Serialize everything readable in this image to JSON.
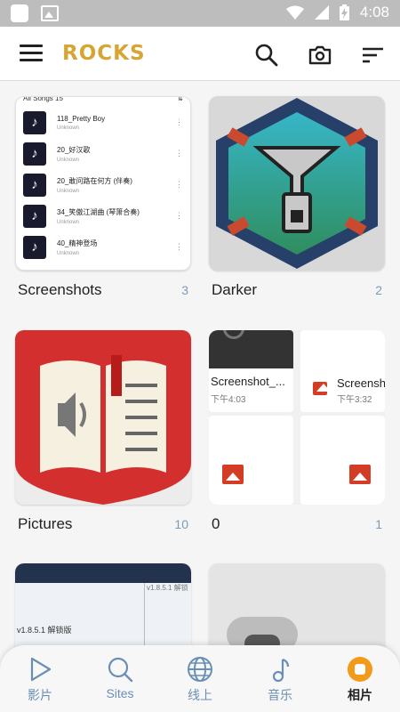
{
  "status_bar": {
    "time": "4:08"
  },
  "header": {
    "logo_text": "ROCKS"
  },
  "albums": [
    {
      "name": "Screenshots",
      "count": "3",
      "preview": {
        "title": "All Songs 15",
        "songs": [
          {
            "title": "118_Pretty Boy",
            "artist": "Unknown"
          },
          {
            "title": "20_好汉歌",
            "artist": "Unknown"
          },
          {
            "title": "20_敢问路在何方 (伴奏)",
            "artist": "Unknown"
          },
          {
            "title": "34_笑傲江湖曲 (琴箫合奏)",
            "artist": "Unknown"
          },
          {
            "title": "40_精神登场",
            "artist": "Unknown"
          }
        ]
      }
    },
    {
      "name": "Darker",
      "count": "2"
    },
    {
      "name": "Pictures",
      "count": "10"
    },
    {
      "name": "0",
      "count": "1",
      "items": [
        {
          "name": "Screenshot_...",
          "time": "下午4:03"
        },
        {
          "name": "Screensh",
          "time": "下午3:32"
        }
      ]
    },
    {
      "preview": {
        "heading": "v1.8.5.1 解锁版",
        "corner_text": "v1.8.5.1 解锁"
      }
    },
    {}
  ],
  "bottom_nav": [
    {
      "label": "影片",
      "icon": "play-icon"
    },
    {
      "label": "Sites",
      "icon": "search-icon"
    },
    {
      "label": "线上",
      "icon": "globe-icon"
    },
    {
      "label": "音乐",
      "icon": "music-note-icon"
    },
    {
      "label": "相片",
      "icon": "photo-icon",
      "active": true
    }
  ],
  "colors": {
    "accent": "#f39a1a",
    "logo": "#d7a533",
    "count": "#7a9bb8",
    "red": "#d33c25"
  }
}
